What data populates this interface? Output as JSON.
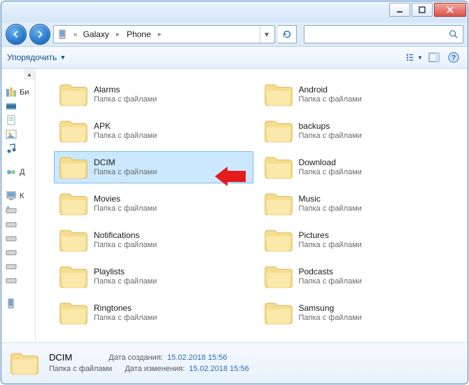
{
  "breadcrumb": {
    "sep": "«",
    "p1": "Galaxy",
    "p2": "Phone"
  },
  "toolbar": {
    "organize": "Упорядочить"
  },
  "sidebar": {
    "lib": "Би",
    "dow": "Д",
    "comp": "К"
  },
  "folder_desc": "Папка с файлами",
  "folders": [
    {
      "name": "Alarms"
    },
    {
      "name": "Android"
    },
    {
      "name": "APK"
    },
    {
      "name": "backups"
    },
    {
      "name": "DCIM",
      "selected": true
    },
    {
      "name": "Download"
    },
    {
      "name": "Movies"
    },
    {
      "name": "Music"
    },
    {
      "name": "Notifications"
    },
    {
      "name": "Pictures"
    },
    {
      "name": "Playlists"
    },
    {
      "name": "Podcasts"
    },
    {
      "name": "Ringtones"
    },
    {
      "name": "Samsung"
    }
  ],
  "details": {
    "name": "DCIM",
    "type": "Папка с файлами",
    "created_label": "Дата создания:",
    "created_value": "15.02.2018 15:56",
    "modified_label": "Дата изменения:",
    "modified_value": "15.02.2018 15:56"
  }
}
